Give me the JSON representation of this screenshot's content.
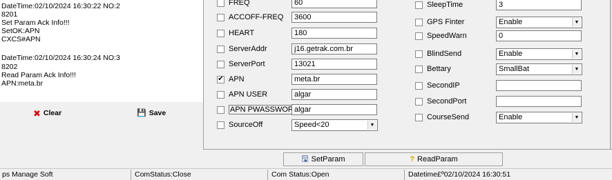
{
  "log": {
    "lines": [
      "DateTime:02/10/2024 16:30:22  NO:2",
      "8201",
      "Set Param Ack Info!!!",
      "SetOK:APN",
      "CXCS#APN",
      "",
      "DateTime:02/10/2024 16:30:24  NO:3",
      "8202",
      "Read Param Ack Info!!!",
      "APN:meta.br"
    ]
  },
  "left_buttons": {
    "clear_label": "Clear",
    "save_label": "Save"
  },
  "params_left": [
    {
      "label": "FREQ",
      "value": "60",
      "checked": false,
      "kind": "text"
    },
    {
      "label": "ACCOFF-FREQ",
      "value": "3600",
      "checked": false,
      "kind": "text"
    },
    {
      "label": "HEART",
      "value": "180",
      "checked": false,
      "kind": "text"
    },
    {
      "label": "ServerAddr",
      "value": "j16.getrak.com.br",
      "checked": false,
      "kind": "text"
    },
    {
      "label": "ServerPort",
      "value": "13021",
      "checked": false,
      "kind": "text"
    },
    {
      "label": "APN",
      "value": "meta.br",
      "checked": true,
      "kind": "text"
    },
    {
      "label": "APN USER",
      "value": "algar",
      "checked": false,
      "kind": "text"
    },
    {
      "label": "APN PWASSWORD",
      "value": "algar",
      "checked": false,
      "kind": "text"
    },
    {
      "label": "SourceOff",
      "value": "Speed<20",
      "checked": false,
      "kind": "select"
    }
  ],
  "params_right": [
    {
      "label": "SleepTime",
      "value": "3",
      "checked": false,
      "kind": "text"
    },
    {
      "label": "GPS Finter",
      "value": "Enable",
      "checked": false,
      "kind": "select"
    },
    {
      "label": "SpeedWarn",
      "value": "0",
      "checked": false,
      "kind": "text"
    },
    {
      "label": "BlindSend",
      "value": "Enable",
      "checked": false,
      "kind": "select"
    },
    {
      "label": "Bettary",
      "value": "SmallBat",
      "checked": false,
      "kind": "select"
    },
    {
      "label": "SecondIP",
      "value": "",
      "checked": false,
      "kind": "text"
    },
    {
      "label": "SecondPort",
      "value": "",
      "checked": false,
      "kind": "text"
    },
    {
      "label": "CourseSend",
      "value": "Enable",
      "checked": false,
      "kind": "select"
    }
  ],
  "param_buttons": {
    "set_label": "SetParam",
    "read_label": "ReadParam"
  },
  "statusbar": {
    "app": "ps Manage Soft",
    "com_status": "ComStatus:Close",
    "com_status2": "Com Status:Open",
    "datetime": "Datetime£º02/10/2024 16:30:51"
  },
  "icons": {
    "check": "✔",
    "dropdown": "▼",
    "clear": "✖",
    "save": "💾",
    "set": "🖫",
    "read": "?"
  },
  "colors": {
    "clear_icon": "#d01010",
    "read_icon": "#d4a000"
  }
}
